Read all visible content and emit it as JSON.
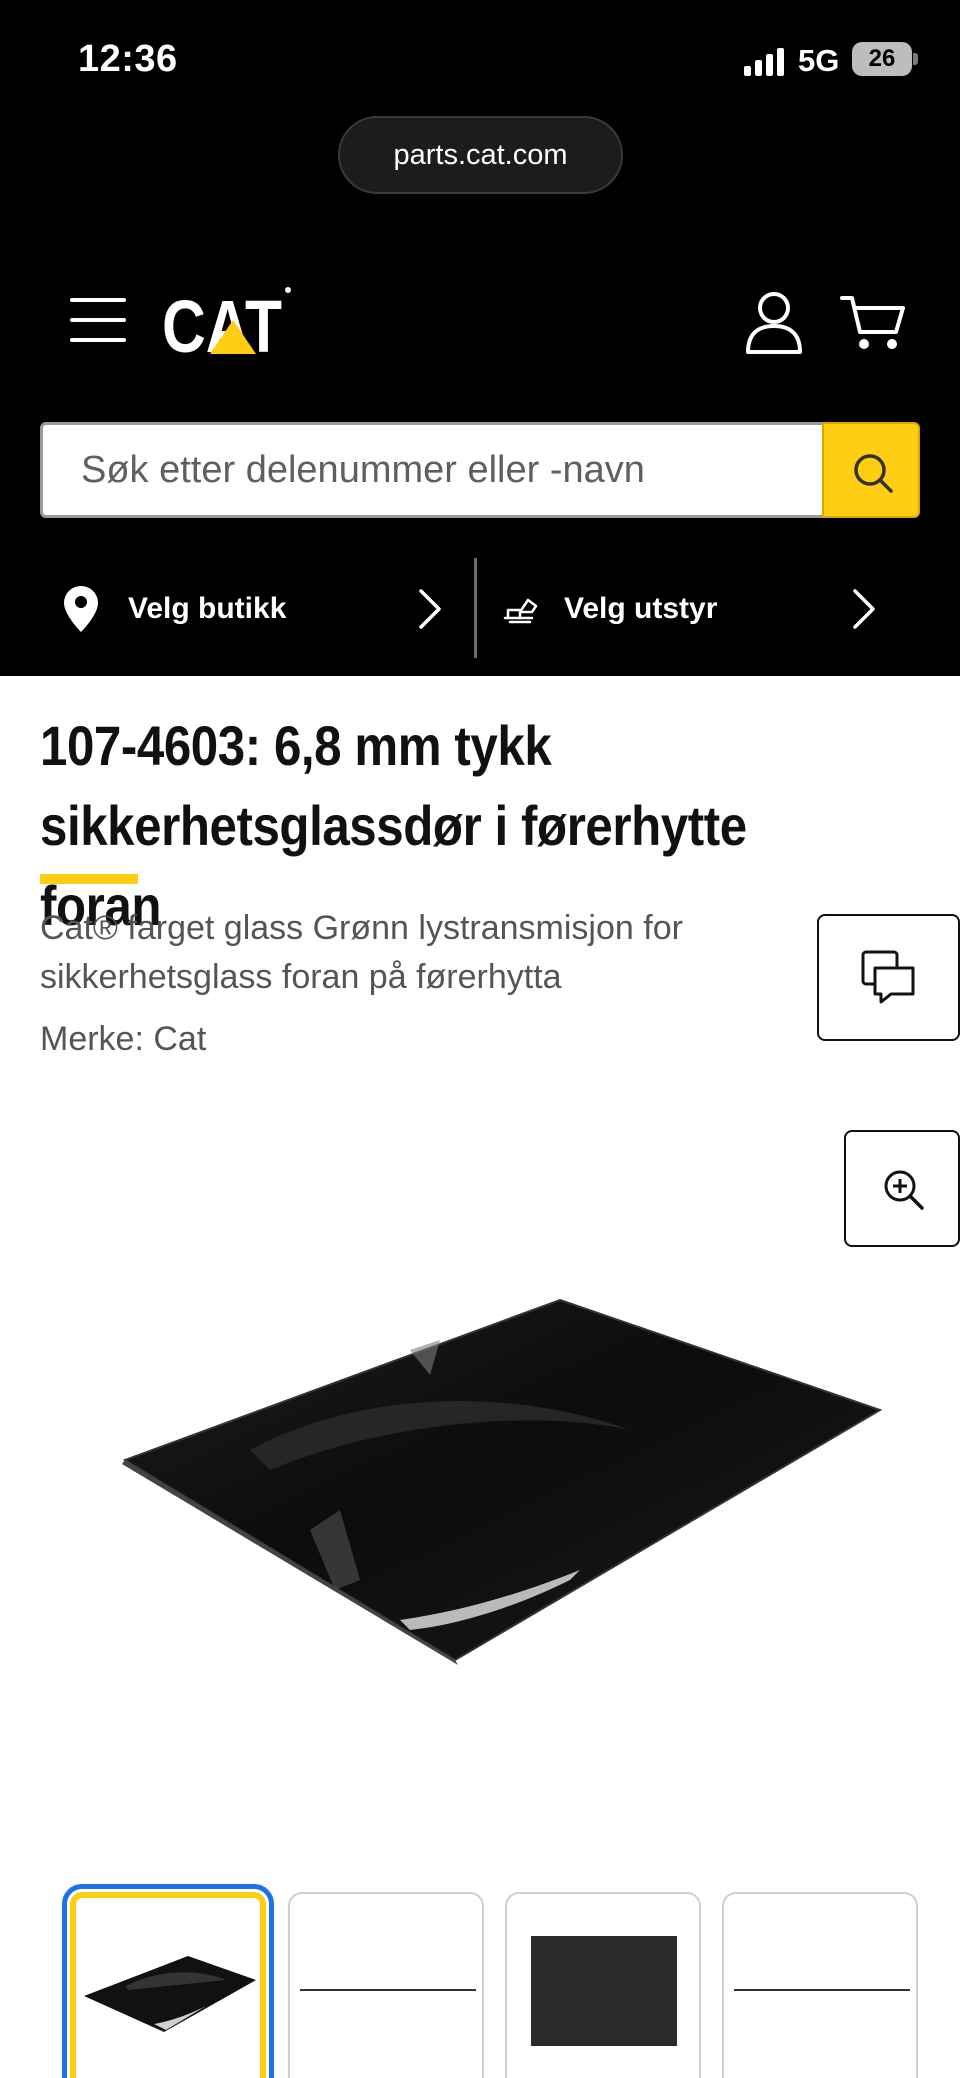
{
  "status_bar": {
    "time": "12:36",
    "network": "5G",
    "battery": "26"
  },
  "browser": {
    "url": "parts.cat.com"
  },
  "header": {
    "logo_text": "CAT",
    "search": {
      "placeholder": "Søk etter delenummer eller -navn"
    },
    "store_selector": {
      "label": "Velg butikk"
    },
    "equipment_selector": {
      "label": "Velg utstyr"
    }
  },
  "product": {
    "title": "107-4603: 6,8 mm tykk sikkerhetsglassdør i førerhytte foran",
    "description": "Cat® farget glass Grønn lystransmisjon for sikkerhetsglass foran på førerhytta",
    "brand": "Merke: Cat"
  },
  "gallery": {
    "thumbnails": [
      {
        "kind": "angled-glass-panel",
        "active": true
      },
      {
        "kind": "side-profile-line",
        "active": false
      },
      {
        "kind": "front-panel",
        "active": false
      },
      {
        "kind": "side-profile-line",
        "active": false
      }
    ]
  },
  "colors": {
    "brand_yellow": "#ffcd11",
    "header_bg": "#000000",
    "focus_blue": "#1a73e8"
  }
}
